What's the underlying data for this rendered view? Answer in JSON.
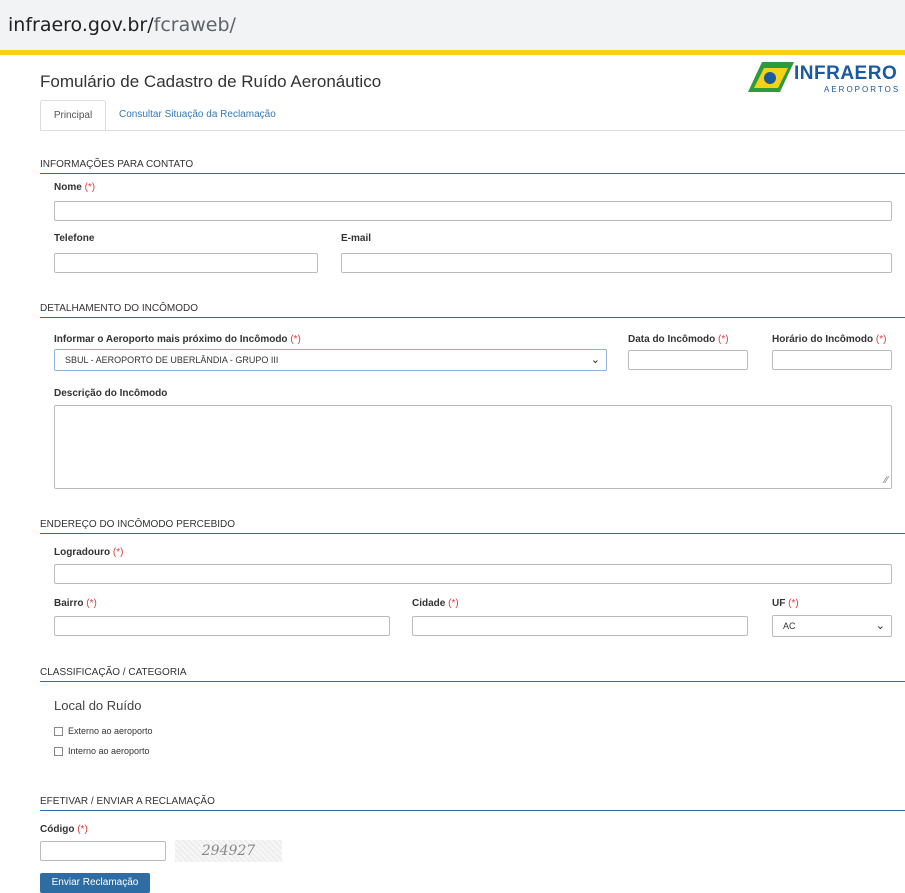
{
  "browser": {
    "url_domain": "infraero.gov.br/",
    "url_path": "fcraweb/"
  },
  "header": {
    "title": "Fomulário de Cadastro de Ruído Aeronáutico",
    "logo_name": "INFRAERO",
    "logo_sub": "AEROPORTOS"
  },
  "tabs": {
    "principal": "Principal",
    "consultar": "Consultar Situação da Reclamação"
  },
  "required_mark": "(*)",
  "contato": {
    "section": "INFORMAÇÕES PARA CONTATO",
    "nome_label": "Nome",
    "telefone_label": "Telefone",
    "email_label": "E-mail"
  },
  "detalhe": {
    "section": "DETALHAMENTO DO INCÔMODO",
    "aeroporto_label": "Informar o Aeroporto mais próximo do Incômodo",
    "aeroporto_value": "SBUL - AEROPORTO DE UBERLÂNDIA - GRUPO III",
    "data_label": "Data do Incômodo",
    "horario_label": "Horário do Incômodo",
    "descricao_label": "Descrição do Incômodo"
  },
  "endereco": {
    "section": "ENDEREÇO DO INCÔMODO PERCEBIDO",
    "logradouro_label": "Logradouro",
    "bairro_label": "Bairro",
    "cidade_label": "Cidade",
    "uf_label": "UF",
    "uf_value": "AC"
  },
  "classificacao": {
    "section": "CLASSIFICAÇÃO / CATEGORIA",
    "local_title": "Local do Ruído",
    "externo": "Externo ao aeroporto",
    "interno": "Interno ao aeroporto"
  },
  "envio": {
    "section": "EFETIVAR / ENVIAR A RECLAMAÇÃO",
    "codigo_label": "Código",
    "captcha": "294927",
    "button": "Enviar Reclamação"
  },
  "colors": {
    "accent": "#2e6da4",
    "required": "#e03a3a",
    "logo_yellow": "#f7d117",
    "logo_green": "#2e9a3e"
  }
}
